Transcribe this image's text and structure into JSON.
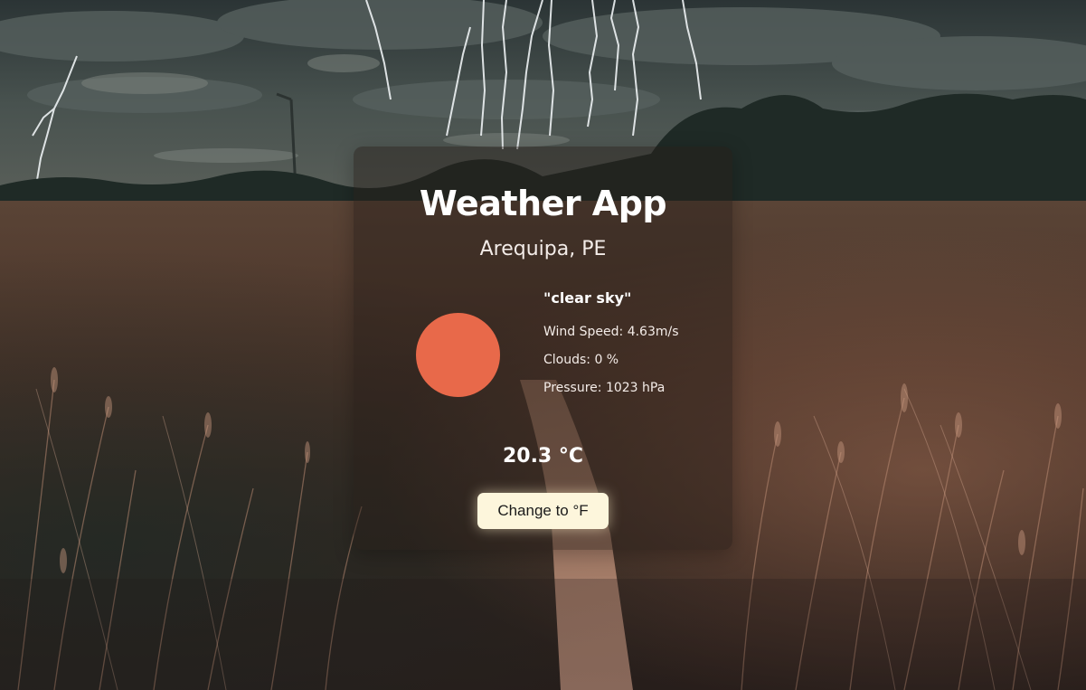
{
  "app": {
    "title": "Weather App",
    "location": "Arequipa, PE"
  },
  "weather": {
    "icon": "sun-icon",
    "icon_color": "#e8694a",
    "description": "\"clear sky\"",
    "wind_speed": "Wind Speed: 4.63m/s",
    "clouds": "Clouds: 0 %",
    "pressure": "Pressure: 1023 hPa",
    "temperature": "20.3 °C"
  },
  "controls": {
    "toggle_unit_label": "Change to °F"
  },
  "theme": {
    "card_background": "rgba(38, 28, 24, 0.45)",
    "button_background": "#fdf6dc",
    "text_color": "#ffffff"
  }
}
